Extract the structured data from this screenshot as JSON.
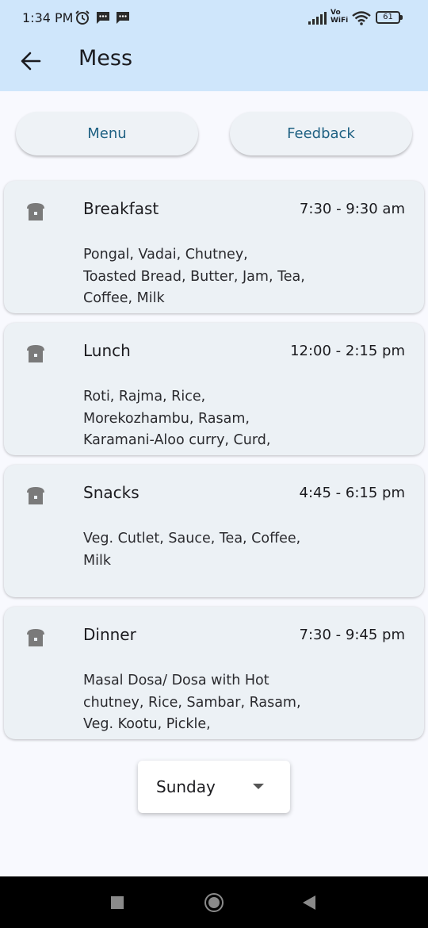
{
  "status_bar": {
    "time": "1:34 PM",
    "network_label_top": "Vo",
    "network_label_bottom": "WiFi",
    "battery": "61",
    "icons": [
      "alarm-icon",
      "message-icon",
      "message-icon",
      "signal-icon",
      "wifi-icon",
      "battery-icon"
    ]
  },
  "app_bar": {
    "title": "Mess",
    "back_icon": "arrow-left-icon",
    "background": "#cfe6fb"
  },
  "tabs": {
    "menu_label": "Menu",
    "feedback_label": "Feedback",
    "accent": "#1f6183"
  },
  "meals": [
    {
      "name": "Breakfast",
      "time": "7:30 - 9:30 am",
      "items": "Pongal, Vadai, Chutney, Toasted Bread, Butter, Jam, Tea, Coffee, Milk",
      "icon": "bread-icon"
    },
    {
      "name": "Lunch",
      "time": "12:00 - 2:15 pm",
      "items": "Roti, Rajma, Rice, Morekozhambu, Rasam, Karamani-Aloo curry, Curd,",
      "icon": "bread-icon"
    },
    {
      "name": "Snacks",
      "time": "4:45 - 6:15 pm",
      "items": "Veg. Cutlet, Sauce, Tea, Coffee, Milk",
      "icon": "bread-icon"
    },
    {
      "name": "Dinner",
      "time": "7:30 - 9:45 pm",
      "items": "Masal Dosa/ Dosa with Hot chutney, Rice, Sambar, Rasam, Veg. Kootu, Pickle,",
      "icon": "bread-icon"
    }
  ],
  "day_selector": {
    "selected": "Sunday",
    "icon": "caret-down-icon"
  },
  "nav_bar": {
    "icons": [
      "recents-icon",
      "home-icon",
      "back-icon"
    ]
  }
}
